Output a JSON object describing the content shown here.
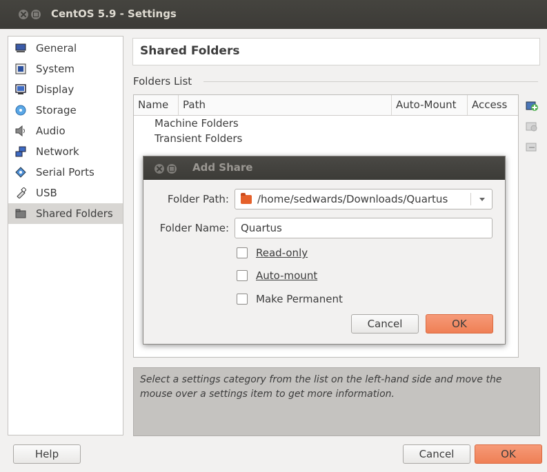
{
  "window": {
    "title": "CentOS 5.9 - Settings"
  },
  "sidebar": {
    "items": [
      {
        "label": "General",
        "icon": "monitor-icon"
      },
      {
        "label": "System",
        "icon": "chip-icon"
      },
      {
        "label": "Display",
        "icon": "display-icon"
      },
      {
        "label": "Storage",
        "icon": "disc-icon"
      },
      {
        "label": "Audio",
        "icon": "speaker-icon"
      },
      {
        "label": "Network",
        "icon": "network-icon"
      },
      {
        "label": "Serial Ports",
        "icon": "serial-icon"
      },
      {
        "label": "USB",
        "icon": "usb-icon"
      },
      {
        "label": "Shared Folders",
        "icon": "folder-icon",
        "selected": true
      }
    ]
  },
  "main": {
    "header": "Shared Folders",
    "folders_list_label": "Folders List",
    "columns": [
      "Name",
      "Path",
      "Auto-Mount",
      "Access"
    ],
    "rows": [
      "Machine Folders",
      "Transient Folders"
    ]
  },
  "dialog": {
    "title": "Add Share",
    "folder_path_label": "Folder Path:",
    "folder_path_value": "/home/sedwards/Downloads/Quartus",
    "folder_name_label": "Folder Name:",
    "folder_name_value": "Quartus",
    "readonly_label": "Read-only",
    "automount_label": "Auto-mount",
    "permanent_label": "Make Permanent",
    "cancel_label": "Cancel",
    "ok_label": "OK"
  },
  "info_text": "Select a settings category from the list on the left-hand side and move the mouse over a settings item to get more information.",
  "footer": {
    "help_label": "Help",
    "cancel_label": "Cancel",
    "ok_label": "OK"
  },
  "colors": {
    "titlebar": "#3c3b37",
    "accent": "#ef7f55",
    "selection": "#d8d6d3"
  }
}
